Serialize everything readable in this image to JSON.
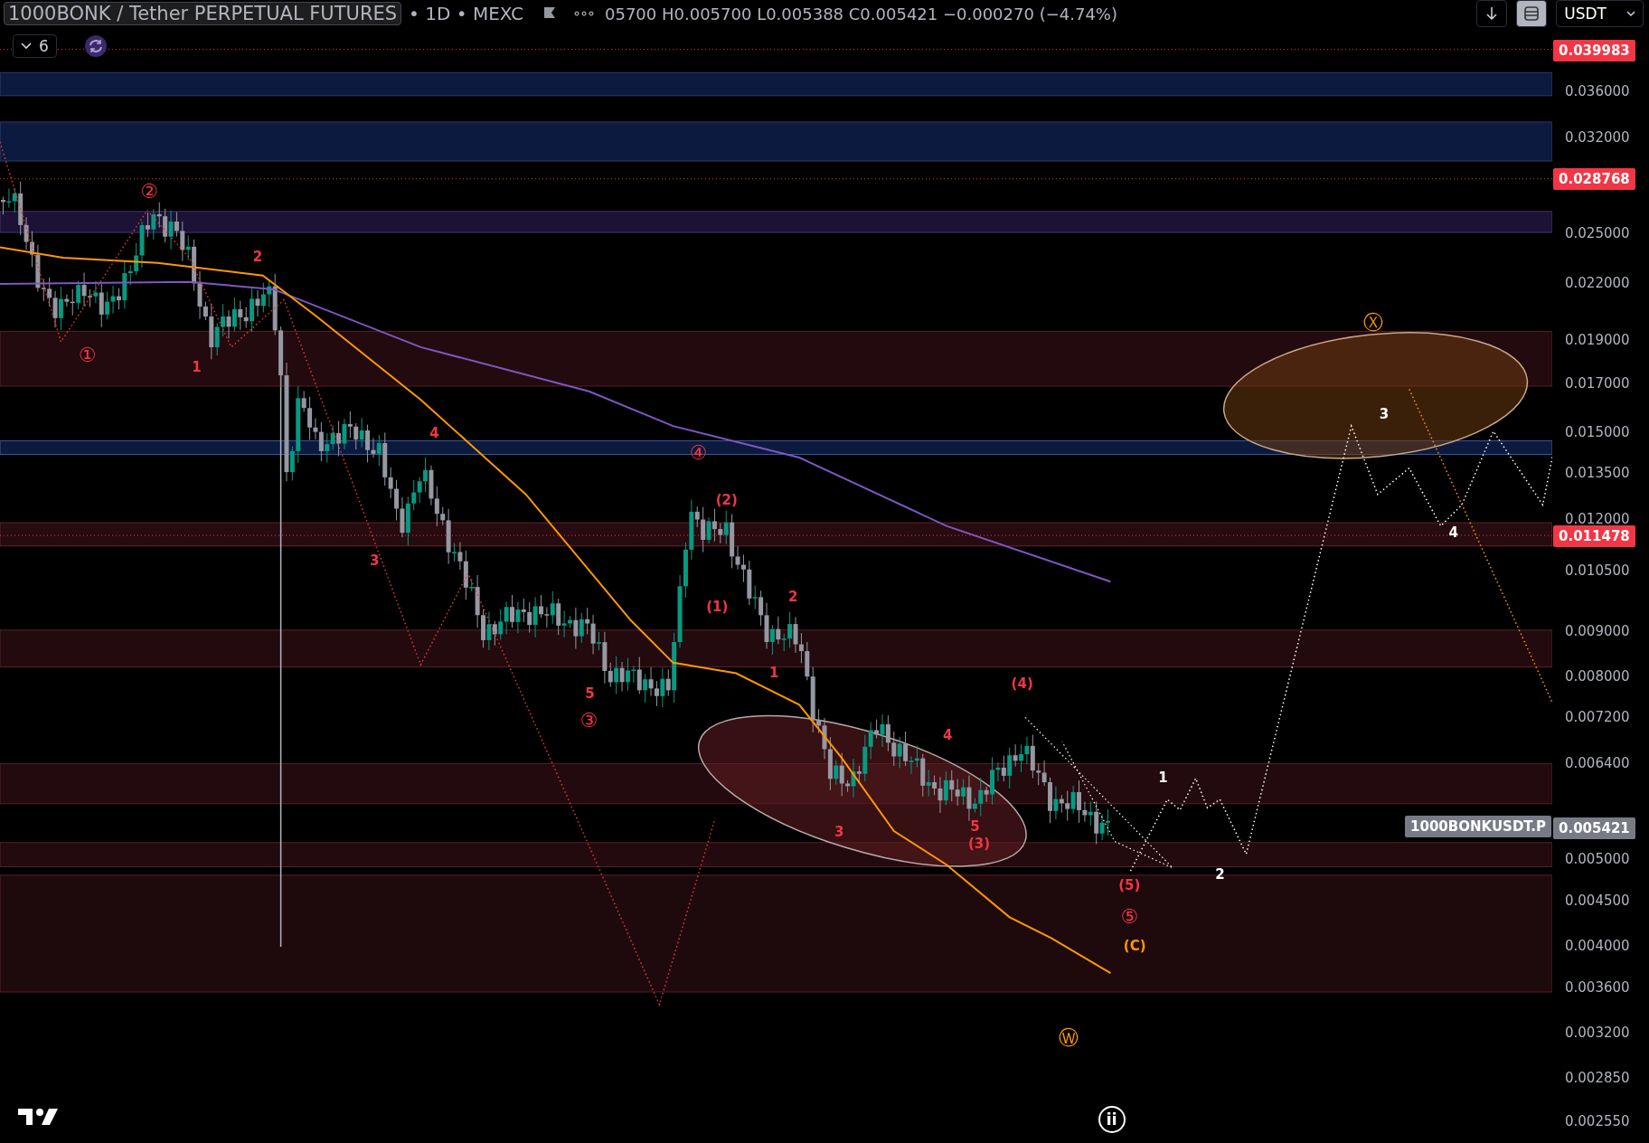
{
  "header": {
    "symbol": "1000BONK / Tether PERPETUAL FUTURES",
    "interval": "• 1D • MEXC",
    "ohlc": "05700 H0.005700 L0.005388 C0.005421 −0.000270 (−4.74%)",
    "currency": "USDT"
  },
  "indicators": {
    "count": "6"
  },
  "price_axis": {
    "ticks": [
      "0.036000",
      "0.032000",
      "0.025000",
      "0.022000",
      "0.019000",
      "0.017000",
      "0.015000",
      "0.013500",
      "0.012000",
      "0.010500",
      "0.009000",
      "0.008000",
      "0.007200",
      "0.006400",
      "0.005000",
      "0.004500",
      "0.004000",
      "0.003600",
      "0.003200",
      "0.002850",
      "0.002550"
    ],
    "tags": [
      {
        "text": "0.039983",
        "kind": "alert"
      },
      {
        "text": "0.028768",
        "kind": "alert"
      },
      {
        "text": "0.011478",
        "kind": "alert"
      },
      {
        "text": "0.005421",
        "kind": "last"
      }
    ]
  },
  "symbol_tag": "1000BONKUSDT.P",
  "annotations": [
    {
      "text": "②",
      "color": "#f23645"
    },
    {
      "text": "①",
      "color": "#f23645"
    },
    {
      "text": "1",
      "color": "#f23645"
    },
    {
      "text": "2",
      "color": "#f23645"
    },
    {
      "text": "3",
      "color": "#f23645"
    },
    {
      "text": "4",
      "color": "#f23645"
    },
    {
      "text": "④",
      "color": "#f23645"
    },
    {
      "text": "(2)",
      "color": "#f23645"
    },
    {
      "text": "(1)",
      "color": "#f23645"
    },
    {
      "text": "2",
      "color": "#f23645"
    },
    {
      "text": "1",
      "color": "#f23645"
    },
    {
      "text": "5",
      "color": "#f23645"
    },
    {
      "text": "③",
      "color": "#f23645"
    },
    {
      "text": "3",
      "color": "#f23645"
    },
    {
      "text": "4",
      "color": "#f23645"
    },
    {
      "text": "5",
      "color": "#f23645"
    },
    {
      "text": "(3)",
      "color": "#f23645"
    },
    {
      "text": "(4)",
      "color": "#f23645"
    },
    {
      "text": "(5)",
      "color": "#f23645"
    },
    {
      "text": "⑤",
      "color": "#f23645"
    },
    {
      "text": "Ⓧ",
      "color": "#ff9800"
    },
    {
      "text": "(C)",
      "color": "#ff9800"
    },
    {
      "text": "Ⓦ",
      "color": "#ff9800"
    },
    {
      "text": "3",
      "color": "#ffffff"
    },
    {
      "text": "4",
      "color": "#ffffff"
    },
    {
      "text": "1",
      "color": "#ffffff"
    },
    {
      "text": "2",
      "color": "#ffffff"
    },
    {
      "text": "ii",
      "color": "#ffffff"
    }
  ]
}
